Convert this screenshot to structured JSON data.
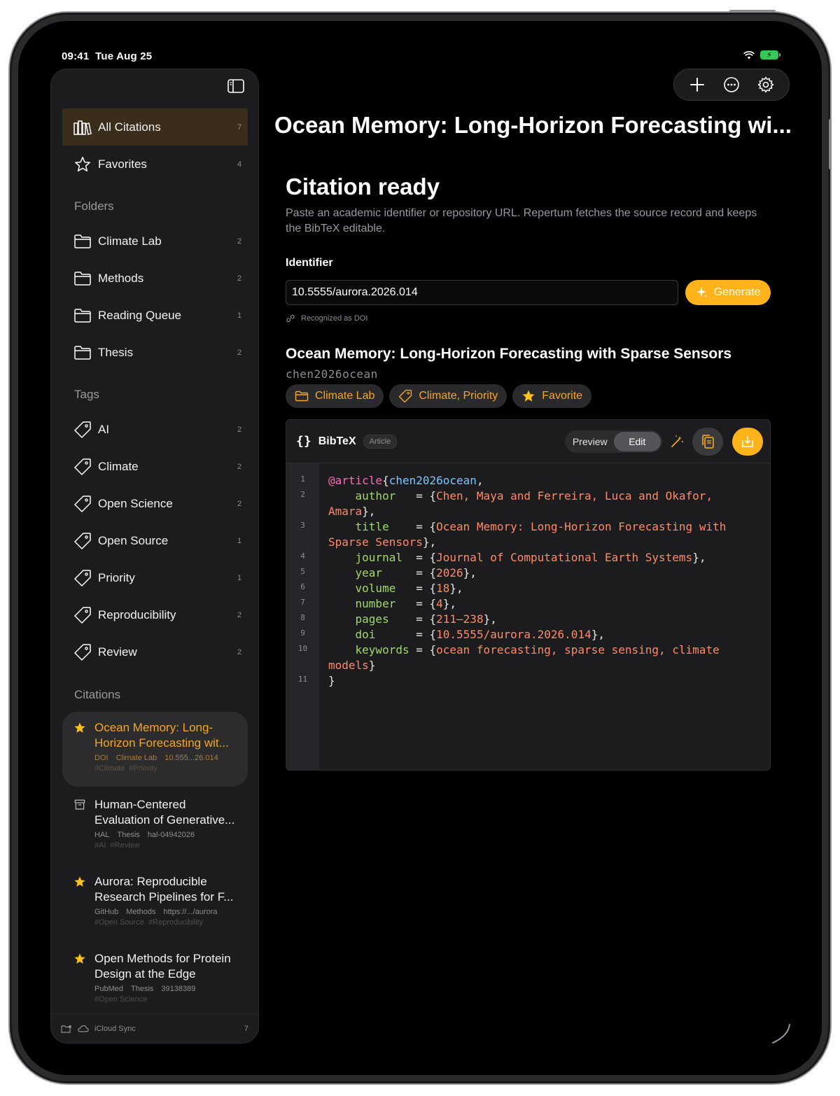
{
  "status": {
    "time": "09:41",
    "date": "Tue Aug 25"
  },
  "sidebar": {
    "library": [
      {
        "label": "All Citations",
        "count": "7",
        "icon": "books-icon"
      },
      {
        "label": "Favorites",
        "count": "4",
        "icon": "star-outline-icon"
      }
    ],
    "folders_heading": "Folders",
    "folders": [
      {
        "label": "Climate Lab",
        "count": "2"
      },
      {
        "label": "Methods",
        "count": "2"
      },
      {
        "label": "Reading Queue",
        "count": "1"
      },
      {
        "label": "Thesis",
        "count": "2"
      }
    ],
    "tags_heading": "Tags",
    "tags": [
      {
        "label": "AI",
        "count": "2"
      },
      {
        "label": "Climate",
        "count": "2"
      },
      {
        "label": "Open Science",
        "count": "2"
      },
      {
        "label": "Open Source",
        "count": "1"
      },
      {
        "label": "Priority",
        "count": "1"
      },
      {
        "label": "Reproducibility",
        "count": "2"
      },
      {
        "label": "Review",
        "count": "2"
      }
    ],
    "citations_heading": "Citations",
    "citations": [
      {
        "title_1": "Ocean Memory: Long-",
        "title_2": "Horizon Forecasting wit...",
        "source": "DOI",
        "folder": "Climate Lab",
        "id": "10.555...26.014",
        "tag1": "#Climate",
        "tag2": "#Priority",
        "icon": "star-filled-icon"
      },
      {
        "title_1": "Human-Centered",
        "title_2": "Evaluation of Generative...",
        "source": "HAL",
        "folder": "Thesis",
        "id": "hal-04942026",
        "tag1": "#AI",
        "tag2": "#Review",
        "icon": "archive-box-icon"
      },
      {
        "title_1": "Aurora: Reproducible",
        "title_2": "Research Pipelines for F...",
        "source": "GitHub",
        "folder": "Methods",
        "id": "https://.../aurora",
        "tag1": "#Open Source",
        "tag2": "#Reproducibility",
        "icon": "star-filled-icon"
      },
      {
        "title_1": "Open Methods for Protein",
        "title_2": "Design at the Edge",
        "source": "PubMed",
        "folder": "Thesis",
        "id": "39138389",
        "tag1": "#Open Science",
        "tag2": "",
        "icon": "star-filled-icon"
      }
    ],
    "footer": {
      "sync_label": "iCloud Sync",
      "count": "7"
    }
  },
  "main": {
    "title": "Ocean Memory: Long-Horizon Forecasting wi...",
    "section_title": "Citation ready",
    "description": "Paste an academic identifier or repository URL. Repertum fetches the source record and keeps the BibTeX editable.",
    "identifier_label": "Identifier",
    "identifier_value": "10.5555/aurora.2026.014",
    "generate_label": "Generate",
    "recognized": "Recognized as DOI",
    "ref_title": "Ocean Memory: Long-Horizon Forecasting with Sparse Sensors",
    "ref_key": "chen2026ocean",
    "chips": {
      "folder": "Climate Lab",
      "tags": "Climate, Priority",
      "favorite": "Favorite"
    },
    "bibtex": {
      "label": "BibTeX",
      "badge": "Article",
      "preview": "Preview",
      "edit": "Edit",
      "line_numbers": [
        "1",
        "2",
        "3",
        "4",
        "5",
        "6",
        "7",
        "8",
        "9",
        "10",
        "11"
      ]
    }
  },
  "colors": {
    "accent": "#ffb31a",
    "active_text": "#f5a623",
    "background": "#000000",
    "panel": "#1c1c1e"
  }
}
